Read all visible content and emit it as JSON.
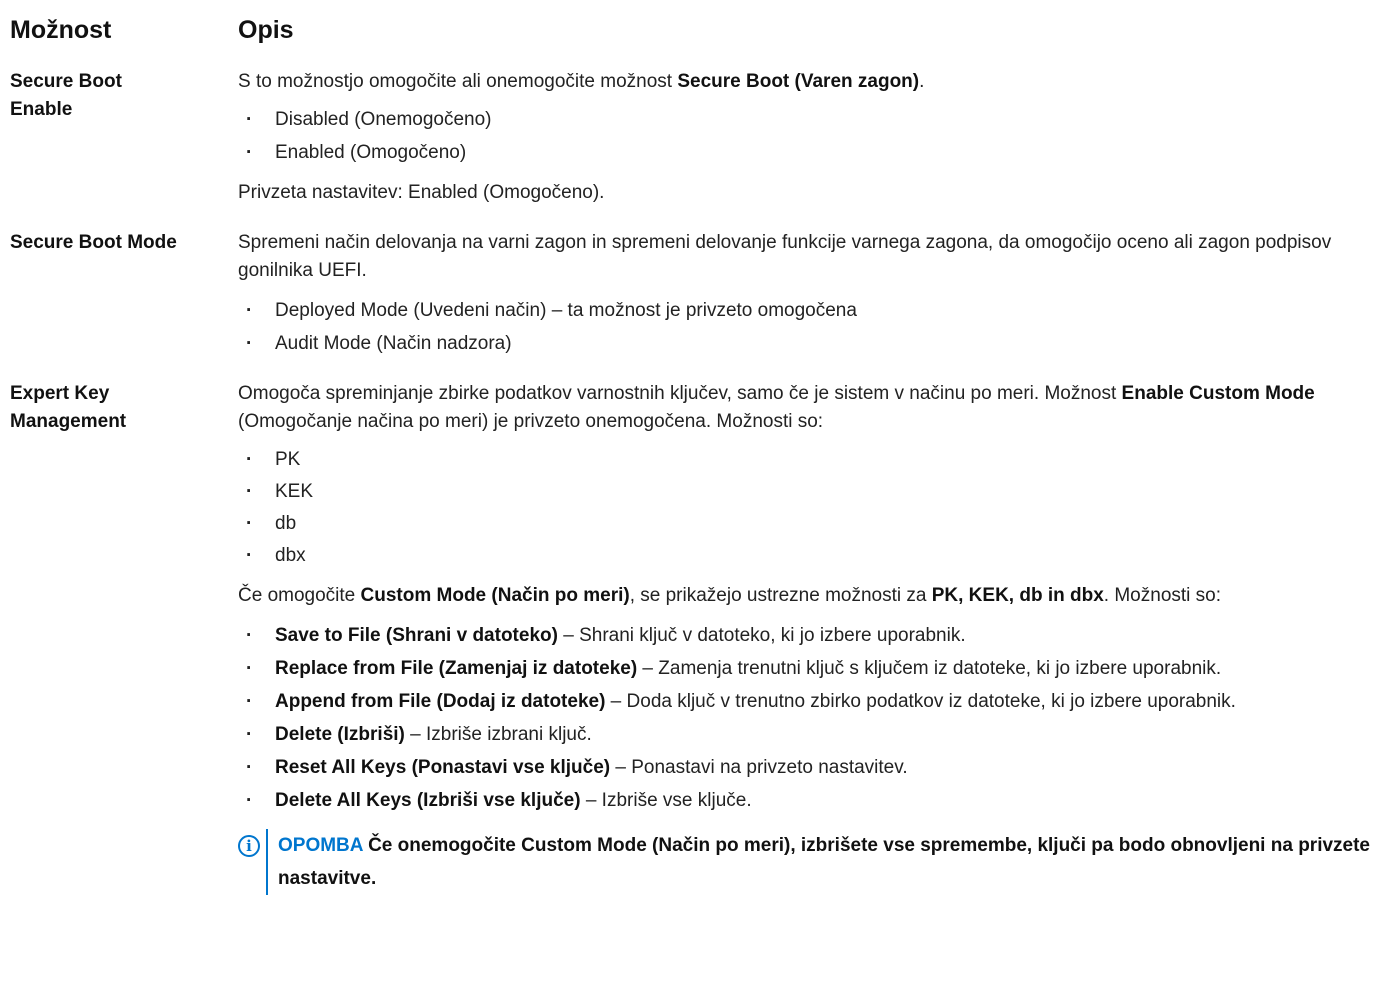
{
  "header": {
    "option": "Možnost",
    "description": "Opis"
  },
  "secure_boot_enable": {
    "label_line1": "Secure Boot",
    "label_line2": "Enable",
    "intro": "S to možnostjo omogočite ali onemogočite možnost ",
    "intro_bold": "Secure Boot (Varen zagon)",
    "intro_end": ".",
    "options": [
      "Disabled (Onemogočeno)",
      "Enabled (Omogočeno)"
    ],
    "default": "Privzeta nastavitev: Enabled (Omogočeno)."
  },
  "secure_boot_mode": {
    "label": "Secure Boot Mode",
    "desc": "Spremeni način delovanja na varni zagon in spremeni delovanje funkcije varnega zagona, da omogočijo oceno ali zagon podpisov gonilnika UEFI.",
    "options": [
      "Deployed Mode (Uvedeni način) – ta možnost je privzeto omogočena",
      "Audit Mode (Način nadzora)"
    ]
  },
  "expert_key_management": {
    "label_line1": "Expert Key",
    "label_line2": "Management",
    "intro": "Omogoča spreminjanje zbirke podatkov varnostnih ključev, samo če je sistem v načinu po meri. Možnost ",
    "intro_bold": "Enable Custom Mode",
    "intro_end": " (Omogočanje načina po meri) je privzeto onemogočena. Možnosti so:",
    "keys": [
      "PK",
      "KEK",
      "db",
      "dbx"
    ],
    "custom_pre": "Če omogočite ",
    "custom_bold1": "Custom Mode (Način po meri)",
    "custom_mid": ", se prikažejo ustrezne možnosti za ",
    "custom_bold2": "PK, KEK, db in dbx",
    "custom_end": ". Možnosti so:",
    "actions": [
      {
        "name": "Save to File (Shrani v datoteko)",
        "desc": " – Shrani ključ v datoteko, ki jo izbere uporabnik."
      },
      {
        "name": "Replace from File (Zamenjaj iz datoteke)",
        "desc": " – Zamenja trenutni ključ s ključem iz datoteke, ki jo izbere uporabnik."
      },
      {
        "name": "Append from File (Dodaj iz datoteke)",
        "desc": " – Doda ključ v trenutno zbirko podatkov iz datoteke, ki jo izbere uporabnik."
      },
      {
        "name": "Delete (Izbriši)",
        "desc": " – Izbriše izbrani ključ."
      },
      {
        "name": "Reset All Keys (Ponastavi vse ključe)",
        "desc": " – Ponastavi na privzeto nastavitev."
      },
      {
        "name": "Delete All Keys (Izbriši vse ključe)",
        "desc": " – Izbriše vse ključe."
      }
    ],
    "note_label": "OPOMBA",
    "note_text": " Če onemogočite Custom Mode (Način po meri), izbrišete vse spremembe, ključi pa bodo obnovljeni na privzete nastavitve.",
    "note_icon": "info-icon",
    "note_color": "#0076ce"
  }
}
